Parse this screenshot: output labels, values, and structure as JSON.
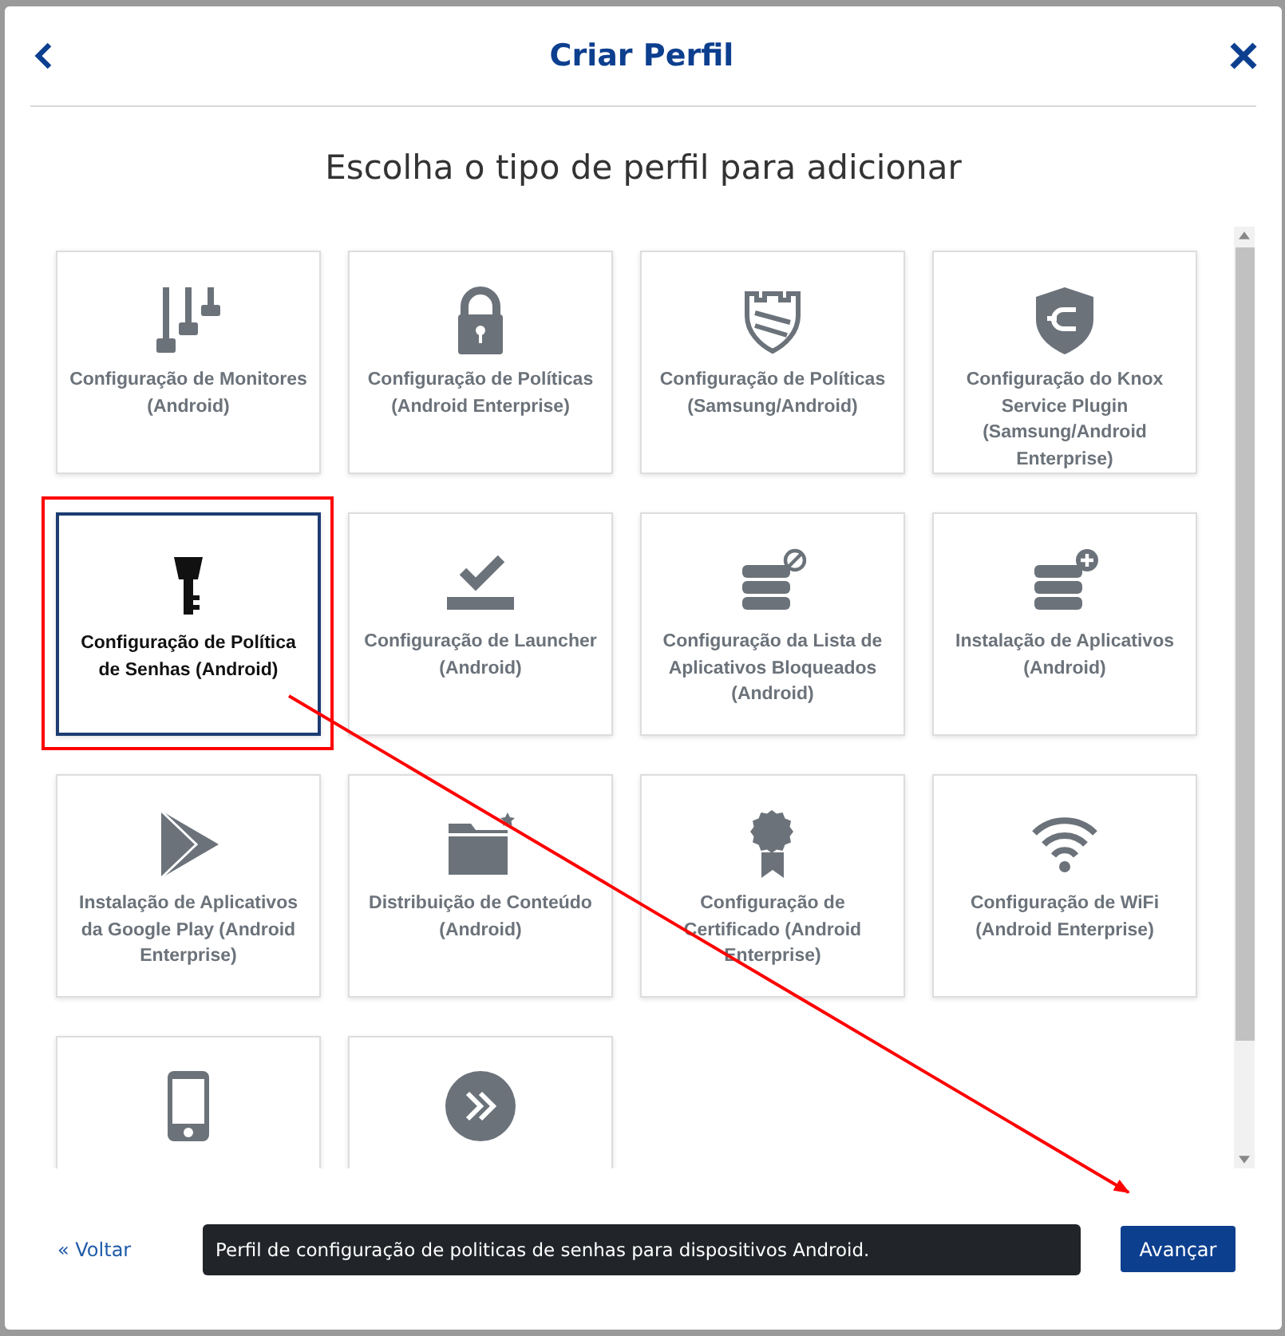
{
  "dialog": {
    "title": "Criar Perfil"
  },
  "heading": "Escolha o tipo de perfil para adicionar",
  "tiles": [
    {
      "label": "Configuração de Monitores (Android)",
      "selected": false
    },
    {
      "label": "Configuração de Políticas (Android Enterprise)",
      "selected": false
    },
    {
      "label": "Configuração de Políticas (Samsung/Android)",
      "selected": false
    },
    {
      "label": "Configuração do Knox Service Plugin (Samsung/Android Enterprise)",
      "selected": false
    },
    {
      "label": "Configuração de Política de Senhas (Android)",
      "selected": true
    },
    {
      "label": "Configuração de Launcher (Android)",
      "selected": false
    },
    {
      "label": "Configuração da Lista de Aplicativos Bloqueados (Android)",
      "selected": false
    },
    {
      "label": "Instalação de Aplicativos (Android)",
      "selected": false
    },
    {
      "label": "Instalação de Aplicativos da Google Play (Android Enterprise)",
      "selected": false
    },
    {
      "label": "Distribuição de Conteúdo (Android)",
      "selected": false
    },
    {
      "label": "Configuração de Certificado (Android Enterprise)",
      "selected": false
    },
    {
      "label": "Configuração de WiFi (Android Enterprise)",
      "selected": false
    },
    {
      "selected": false
    },
    {
      "selected": false
    }
  ],
  "footer": {
    "back_link": "« Voltar",
    "description": "Perfil de configuração de politicas de senhas para dispositivos Android.",
    "next_button": "Avançar"
  }
}
